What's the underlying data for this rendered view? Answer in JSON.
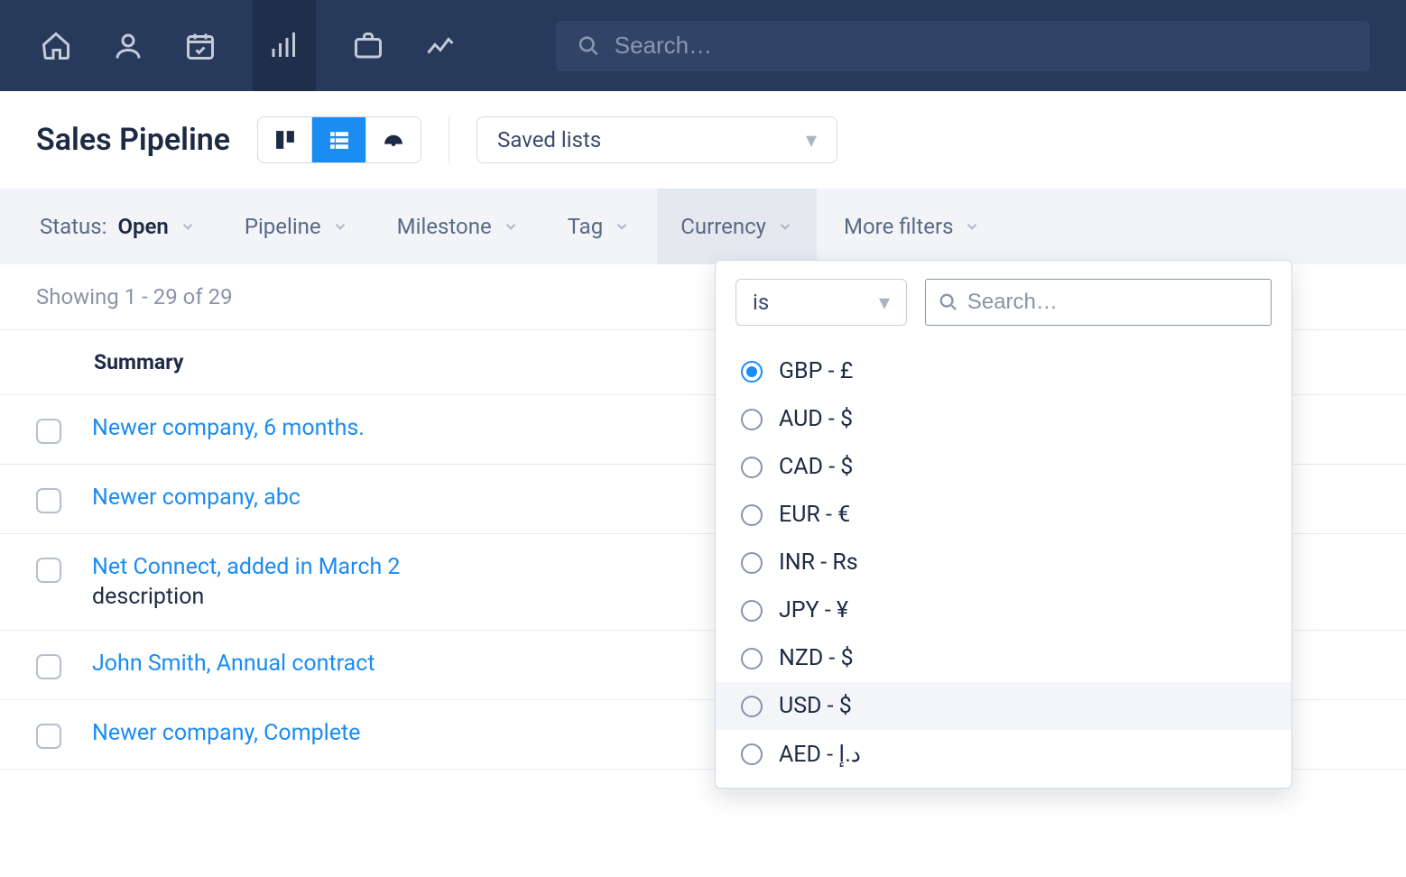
{
  "topnav": {
    "search_placeholder": "Search…"
  },
  "page": {
    "title": "Sales Pipeline",
    "saved_lists_label": "Saved lists"
  },
  "filters": {
    "status_label": "Status:",
    "status_value": "Open",
    "pipeline": "Pipeline",
    "milestone": "Milestone",
    "tag": "Tag",
    "currency": "Currency",
    "more": "More filters"
  },
  "showing_text": "Showing 1 - 29 of 29",
  "table": {
    "summary_header": "Summary",
    "rows": [
      {
        "title": "Newer company, 6 months.",
        "sub": ""
      },
      {
        "title": "Newer company, abc",
        "sub": ""
      },
      {
        "title": "Net Connect, added in March 2",
        "sub": "description"
      },
      {
        "title": "John Smith, Annual contract",
        "sub": ""
      },
      {
        "title": "Newer company, Complete",
        "sub": ""
      }
    ]
  },
  "currency_dropdown": {
    "operator": "is",
    "search_placeholder": "Search…",
    "options": [
      {
        "label": "GBP - £",
        "selected": true,
        "hover": false
      },
      {
        "label": "AUD - $",
        "selected": false,
        "hover": false
      },
      {
        "label": "CAD - $",
        "selected": false,
        "hover": false
      },
      {
        "label": "EUR - €",
        "selected": false,
        "hover": false
      },
      {
        "label": "INR - Rs",
        "selected": false,
        "hover": false
      },
      {
        "label": "JPY - ¥",
        "selected": false,
        "hover": false
      },
      {
        "label": "NZD - $",
        "selected": false,
        "hover": false
      },
      {
        "label": "USD - $",
        "selected": false,
        "hover": true
      },
      {
        "label": "AED - د.إ",
        "selected": false,
        "hover": false
      }
    ]
  }
}
